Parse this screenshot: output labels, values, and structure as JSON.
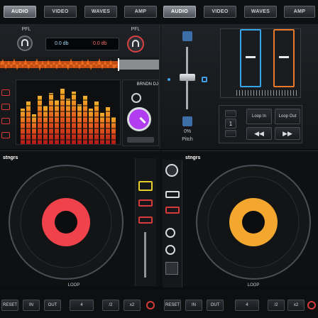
{
  "top_tabs_left": [
    "AUDIO",
    "VIDEO",
    "WAVES",
    "AMP"
  ],
  "top_tabs_right": [
    "AUDIO",
    "VIDEO",
    "WAVES",
    "AMP"
  ],
  "active_tab_left": "AUDIO",
  "active_tab_right": "AUDIO",
  "pfl_left": "PFL",
  "pfl_right": "PFL",
  "gain_left": "0.0 db",
  "gain_right": "0.0 db",
  "fx_brand": "BRNDN DJ",
  "pitch_value": "0%",
  "pitch_label": "Pitch",
  "loop_in": "Loop In",
  "loop_out": "Loop Out",
  "loop_counter": "1",
  "deck_left_brand": "stngrs",
  "deck_right_brand": "stngrs",
  "deck_left_label": "LOOP",
  "deck_right_label": "LOOP",
  "bottom_left_buttons": [
    "RESET",
    "IN",
    "OUT",
    "4",
    "/2",
    "x2"
  ],
  "bottom_right_buttons": [
    "RESET",
    "IN",
    "OUT",
    "4",
    "/2",
    "x2"
  ],
  "colors": {
    "waveform": "#f07020",
    "platter_left": "#f0424a",
    "platter_right": "#f3a72f",
    "fader_left": "#35a5e8",
    "fader_right": "#e8782a",
    "knob": "#b23cf0"
  }
}
